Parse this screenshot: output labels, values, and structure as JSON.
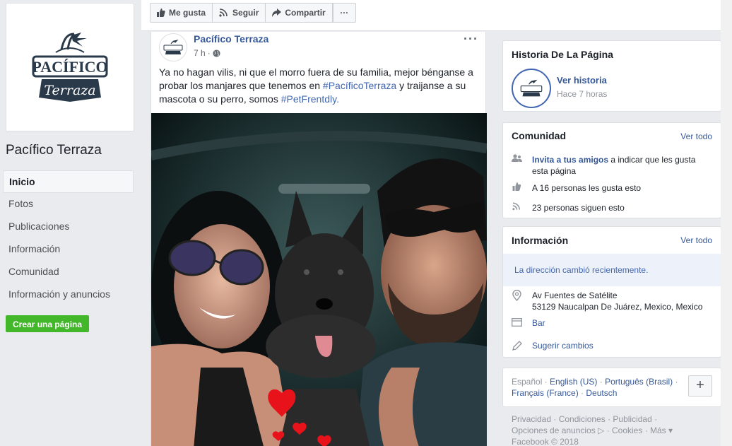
{
  "page": {
    "name": "Pacífico Terraza",
    "logo": {
      "line1": "PACÍFICO",
      "line2": "Terraza"
    }
  },
  "nav": {
    "items": [
      {
        "label": "Inicio",
        "active": true
      },
      {
        "label": "Fotos"
      },
      {
        "label": "Publicaciones"
      },
      {
        "label": "Información"
      },
      {
        "label": "Comunidad"
      },
      {
        "label": "Información y anuncios"
      }
    ],
    "create_page": "Crear una página"
  },
  "toolbar": {
    "like": "Me gusta",
    "follow": "Seguir",
    "share": "Compartir",
    "more": "···"
  },
  "post": {
    "author": "Pacífico Terraza",
    "time": "7 h",
    "text_before": "Ya no hagan vilis, ni que el morro fuera de su familia, mejor bénganse a probar los manjares que tenemos en ",
    "hashtag1": "#PacíficoTerraza",
    "text_middle": " y traijanse a su mascota o su perro, somos ",
    "hashtag2": "#PetFrentdly.",
    "options": "···"
  },
  "story": {
    "title": "Historia De La Página",
    "link": "Ver historia",
    "time": "Hace 7 horas"
  },
  "community": {
    "title": "Comunidad",
    "see_all": "Ver todo",
    "invite_link": "Invita a tus amigos",
    "invite_rest": " a indicar que les gusta esta página",
    "likes": "A 16 personas les gusta esto",
    "follows": "23 personas siguen esto"
  },
  "info": {
    "title": "Información",
    "see_all": "Ver todo",
    "notice": "La dirección cambió recientemente.",
    "address_line1": "Av Fuentes de Satélite",
    "address_line2": "53129 Naucalpan De Juárez, Mexico, Mexico",
    "category": "Bar",
    "suggest": "Sugerir cambios"
  },
  "languages": {
    "current": "Español",
    "others_line1": [
      "English (US)",
      "Português (Brasil)"
    ],
    "others_line2": [
      "Français (France)",
      "Deutsch"
    ],
    "add": "+"
  },
  "footer": {
    "line1": "Privacidad · Condiciones · Publicidad ·",
    "line2": "Opciones de anuncios ▷ · Cookies · Más ▾",
    "copyright": "Facebook © 2018"
  },
  "colors": {
    "link": "#365899",
    "accent": "#4267b2",
    "green": "#42b72a",
    "background": "#e9ebee"
  }
}
